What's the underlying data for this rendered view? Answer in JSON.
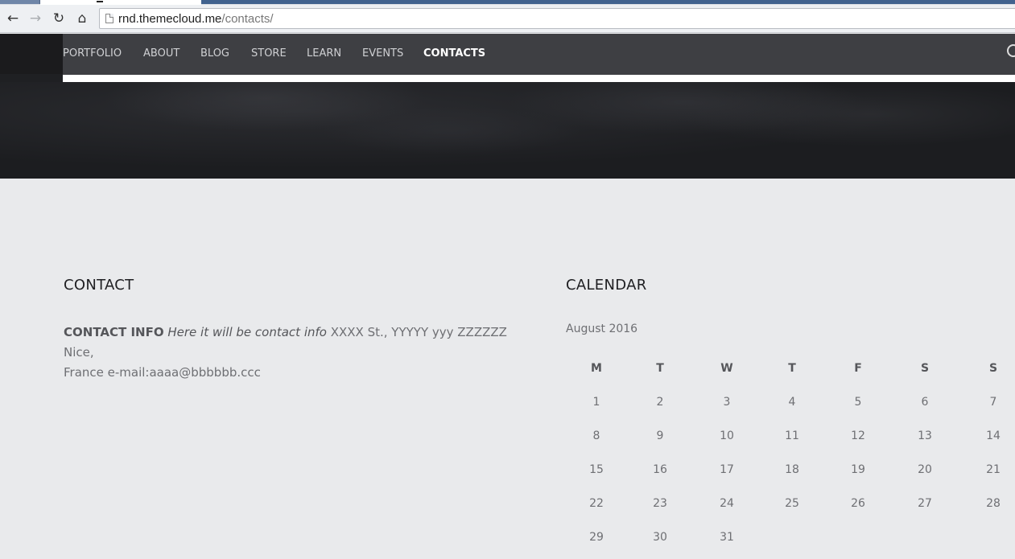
{
  "browser": {
    "url_host": "rnd.themecloud.me",
    "url_path": "/contacts/"
  },
  "site_nav": {
    "items": [
      {
        "label": "PORTFOLIO",
        "active": false
      },
      {
        "label": "ABOUT",
        "active": false
      },
      {
        "label": "BLOG",
        "active": false
      },
      {
        "label": "STORE",
        "active": false
      },
      {
        "label": "LEARN",
        "active": false
      },
      {
        "label": "EVENTS",
        "active": false
      },
      {
        "label": "CONTACTS",
        "active": true
      }
    ]
  },
  "contact": {
    "title": "CONTACT",
    "label": "CONTACT INFO",
    "italic_text": "Here it will be contact info",
    "line1_rest": " XXXX St., YYYYY yyy ZZZZZZ Nice,",
    "line2": "France e-mail:aaaa@bbbbbb.ccc"
  },
  "calendar": {
    "title": "CALENDAR",
    "month": "August 2016",
    "weekdays": [
      "M",
      "T",
      "W",
      "T",
      "F",
      "S",
      "S"
    ],
    "weeks": [
      [
        "1",
        "2",
        "3",
        "4",
        "5",
        "6",
        "7"
      ],
      [
        "8",
        "9",
        "10",
        "11",
        "12",
        "13",
        "14"
      ],
      [
        "15",
        "16",
        "17",
        "18",
        "19",
        "20",
        "21"
      ],
      [
        "22",
        "23",
        "24",
        "25",
        "26",
        "27",
        "28"
      ],
      [
        "29",
        "30",
        "31",
        "",
        "",
        "",
        ""
      ]
    ]
  }
}
